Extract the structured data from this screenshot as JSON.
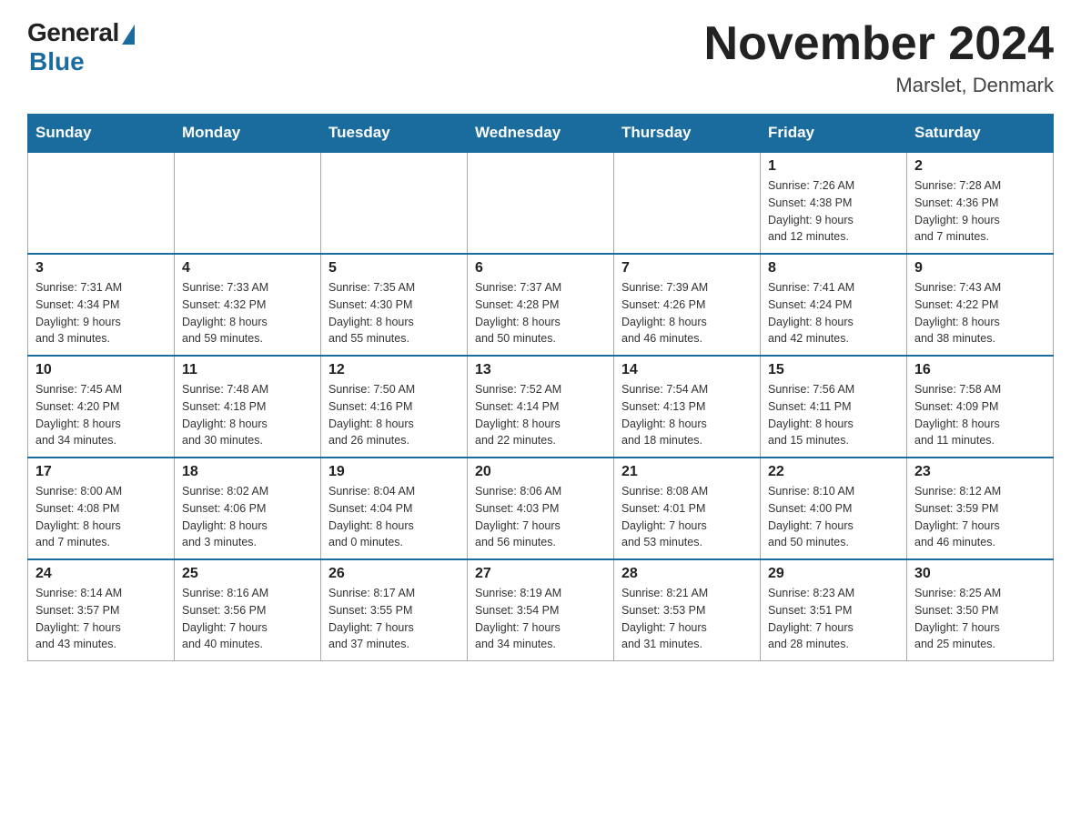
{
  "header": {
    "logo_general": "General",
    "logo_blue": "Blue",
    "month_title": "November 2024",
    "location": "Marslet, Denmark"
  },
  "days_of_week": [
    "Sunday",
    "Monday",
    "Tuesday",
    "Wednesday",
    "Thursday",
    "Friday",
    "Saturday"
  ],
  "weeks": [
    [
      {
        "day": "",
        "info": ""
      },
      {
        "day": "",
        "info": ""
      },
      {
        "day": "",
        "info": ""
      },
      {
        "day": "",
        "info": ""
      },
      {
        "day": "",
        "info": ""
      },
      {
        "day": "1",
        "info": "Sunrise: 7:26 AM\nSunset: 4:38 PM\nDaylight: 9 hours\nand 12 minutes."
      },
      {
        "day": "2",
        "info": "Sunrise: 7:28 AM\nSunset: 4:36 PM\nDaylight: 9 hours\nand 7 minutes."
      }
    ],
    [
      {
        "day": "3",
        "info": "Sunrise: 7:31 AM\nSunset: 4:34 PM\nDaylight: 9 hours\nand 3 minutes."
      },
      {
        "day": "4",
        "info": "Sunrise: 7:33 AM\nSunset: 4:32 PM\nDaylight: 8 hours\nand 59 minutes."
      },
      {
        "day": "5",
        "info": "Sunrise: 7:35 AM\nSunset: 4:30 PM\nDaylight: 8 hours\nand 55 minutes."
      },
      {
        "day": "6",
        "info": "Sunrise: 7:37 AM\nSunset: 4:28 PM\nDaylight: 8 hours\nand 50 minutes."
      },
      {
        "day": "7",
        "info": "Sunrise: 7:39 AM\nSunset: 4:26 PM\nDaylight: 8 hours\nand 46 minutes."
      },
      {
        "day": "8",
        "info": "Sunrise: 7:41 AM\nSunset: 4:24 PM\nDaylight: 8 hours\nand 42 minutes."
      },
      {
        "day": "9",
        "info": "Sunrise: 7:43 AM\nSunset: 4:22 PM\nDaylight: 8 hours\nand 38 minutes."
      }
    ],
    [
      {
        "day": "10",
        "info": "Sunrise: 7:45 AM\nSunset: 4:20 PM\nDaylight: 8 hours\nand 34 minutes."
      },
      {
        "day": "11",
        "info": "Sunrise: 7:48 AM\nSunset: 4:18 PM\nDaylight: 8 hours\nand 30 minutes."
      },
      {
        "day": "12",
        "info": "Sunrise: 7:50 AM\nSunset: 4:16 PM\nDaylight: 8 hours\nand 26 minutes."
      },
      {
        "day": "13",
        "info": "Sunrise: 7:52 AM\nSunset: 4:14 PM\nDaylight: 8 hours\nand 22 minutes."
      },
      {
        "day": "14",
        "info": "Sunrise: 7:54 AM\nSunset: 4:13 PM\nDaylight: 8 hours\nand 18 minutes."
      },
      {
        "day": "15",
        "info": "Sunrise: 7:56 AM\nSunset: 4:11 PM\nDaylight: 8 hours\nand 15 minutes."
      },
      {
        "day": "16",
        "info": "Sunrise: 7:58 AM\nSunset: 4:09 PM\nDaylight: 8 hours\nand 11 minutes."
      }
    ],
    [
      {
        "day": "17",
        "info": "Sunrise: 8:00 AM\nSunset: 4:08 PM\nDaylight: 8 hours\nand 7 minutes."
      },
      {
        "day": "18",
        "info": "Sunrise: 8:02 AM\nSunset: 4:06 PM\nDaylight: 8 hours\nand 3 minutes."
      },
      {
        "day": "19",
        "info": "Sunrise: 8:04 AM\nSunset: 4:04 PM\nDaylight: 8 hours\nand 0 minutes."
      },
      {
        "day": "20",
        "info": "Sunrise: 8:06 AM\nSunset: 4:03 PM\nDaylight: 7 hours\nand 56 minutes."
      },
      {
        "day": "21",
        "info": "Sunrise: 8:08 AM\nSunset: 4:01 PM\nDaylight: 7 hours\nand 53 minutes."
      },
      {
        "day": "22",
        "info": "Sunrise: 8:10 AM\nSunset: 4:00 PM\nDaylight: 7 hours\nand 50 minutes."
      },
      {
        "day": "23",
        "info": "Sunrise: 8:12 AM\nSunset: 3:59 PM\nDaylight: 7 hours\nand 46 minutes."
      }
    ],
    [
      {
        "day": "24",
        "info": "Sunrise: 8:14 AM\nSunset: 3:57 PM\nDaylight: 7 hours\nand 43 minutes."
      },
      {
        "day": "25",
        "info": "Sunrise: 8:16 AM\nSunset: 3:56 PM\nDaylight: 7 hours\nand 40 minutes."
      },
      {
        "day": "26",
        "info": "Sunrise: 8:17 AM\nSunset: 3:55 PM\nDaylight: 7 hours\nand 37 minutes."
      },
      {
        "day": "27",
        "info": "Sunrise: 8:19 AM\nSunset: 3:54 PM\nDaylight: 7 hours\nand 34 minutes."
      },
      {
        "day": "28",
        "info": "Sunrise: 8:21 AM\nSunset: 3:53 PM\nDaylight: 7 hours\nand 31 minutes."
      },
      {
        "day": "29",
        "info": "Sunrise: 8:23 AM\nSunset: 3:51 PM\nDaylight: 7 hours\nand 28 minutes."
      },
      {
        "day": "30",
        "info": "Sunrise: 8:25 AM\nSunset: 3:50 PM\nDaylight: 7 hours\nand 25 minutes."
      }
    ]
  ]
}
